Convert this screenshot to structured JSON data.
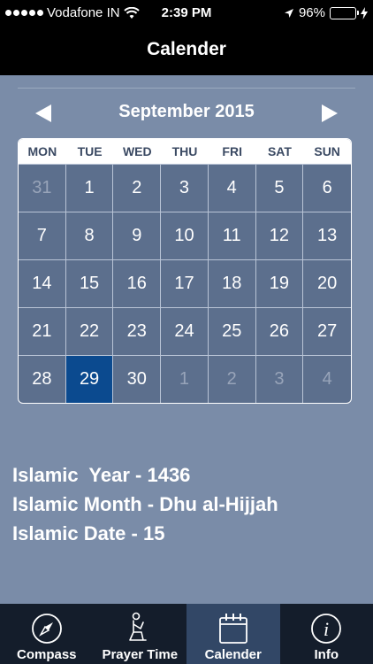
{
  "status_bar": {
    "carrier": "Vodafone IN",
    "time": "2:39 PM",
    "battery": "96%",
    "battery_level": 0.96
  },
  "nav": {
    "title": "Calender"
  },
  "calendar": {
    "month_title": "September 2015",
    "weekdays": [
      "MON",
      "TUE",
      "WED",
      "THU",
      "FRI",
      "SAT",
      "SUN"
    ],
    "days": [
      {
        "d": "31",
        "other": true
      },
      {
        "d": "1"
      },
      {
        "d": "2"
      },
      {
        "d": "3"
      },
      {
        "d": "4"
      },
      {
        "d": "5"
      },
      {
        "d": "6"
      },
      {
        "d": "7"
      },
      {
        "d": "8"
      },
      {
        "d": "9"
      },
      {
        "d": "10"
      },
      {
        "d": "11"
      },
      {
        "d": "12"
      },
      {
        "d": "13"
      },
      {
        "d": "14"
      },
      {
        "d": "15"
      },
      {
        "d": "16"
      },
      {
        "d": "17"
      },
      {
        "d": "18"
      },
      {
        "d": "19"
      },
      {
        "d": "20"
      },
      {
        "d": "21"
      },
      {
        "d": "22"
      },
      {
        "d": "23"
      },
      {
        "d": "24"
      },
      {
        "d": "25"
      },
      {
        "d": "26"
      },
      {
        "d": "27"
      },
      {
        "d": "28"
      },
      {
        "d": "29",
        "today": true
      },
      {
        "d": "30"
      },
      {
        "d": "1",
        "other": true
      },
      {
        "d": "2",
        "other": true
      },
      {
        "d": "3",
        "other": true
      },
      {
        "d": "4",
        "other": true
      }
    ]
  },
  "islamic": {
    "year_line": "Islamic  Year - 1436",
    "month_line": "Islamic Month - Dhu al-Hijjah",
    "date_line": "Islamic Date - 15"
  },
  "tabs": [
    {
      "label": "Compass",
      "icon": "compass-icon",
      "active": false
    },
    {
      "label": "Prayer Time",
      "icon": "prayer-icon",
      "active": false
    },
    {
      "label": "Calender",
      "icon": "calendar-icon",
      "active": true
    },
    {
      "label": "Info",
      "icon": "info-icon",
      "active": false
    }
  ],
  "colors": {
    "background": "#7a8ca8",
    "today_highlight": "#0b4a8f",
    "tab_active": "#324766",
    "battery_fill": "#4cd964"
  }
}
